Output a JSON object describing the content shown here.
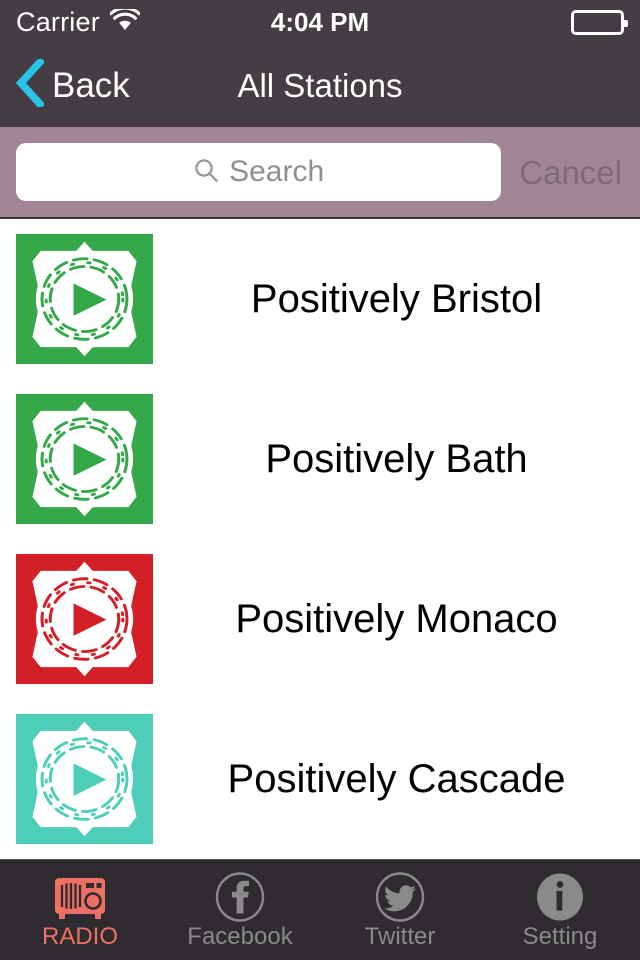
{
  "status_bar": {
    "carrier": "Carrier",
    "wifi_icon": "wifi-icon",
    "time": "4:04 PM",
    "battery_icon": "battery-icon"
  },
  "nav_bar": {
    "back_icon": "chevron-left-icon",
    "back_label": "Back",
    "title": "All Stations"
  },
  "search": {
    "icon": "search-icon",
    "placeholder": "Search",
    "value": "",
    "cancel_label": "Cancel"
  },
  "stations": [
    {
      "name": "Positively Bristol",
      "logo_color": "#35a949",
      "logo_icon": "dna-play-logo"
    },
    {
      "name": "Positively Bath",
      "logo_color": "#35a949",
      "logo_icon": "dna-play-logo"
    },
    {
      "name": "Positively Monaco",
      "logo_color": "#d41f26",
      "logo_icon": "dna-play-logo"
    },
    {
      "name": "Positively Cascade",
      "logo_color": "#4ecdb8",
      "logo_icon": "dna-play-logo"
    }
  ],
  "tab_bar": {
    "items": [
      {
        "label": "RADIO",
        "icon": "radio-icon",
        "active": true
      },
      {
        "label": "Facebook",
        "icon": "facebook-icon",
        "active": false
      },
      {
        "label": "Twitter",
        "icon": "twitter-icon",
        "active": false
      },
      {
        "label": "Setting",
        "icon": "info-icon",
        "active": false
      }
    ]
  },
  "colors": {
    "nav_background": "#443e44",
    "search_background": "#a28592",
    "tab_background": "#2f2b30",
    "accent_back": "#29c5e8",
    "accent_active_tab": "#ec7063",
    "inactive_tab": "#8a8a8a"
  }
}
